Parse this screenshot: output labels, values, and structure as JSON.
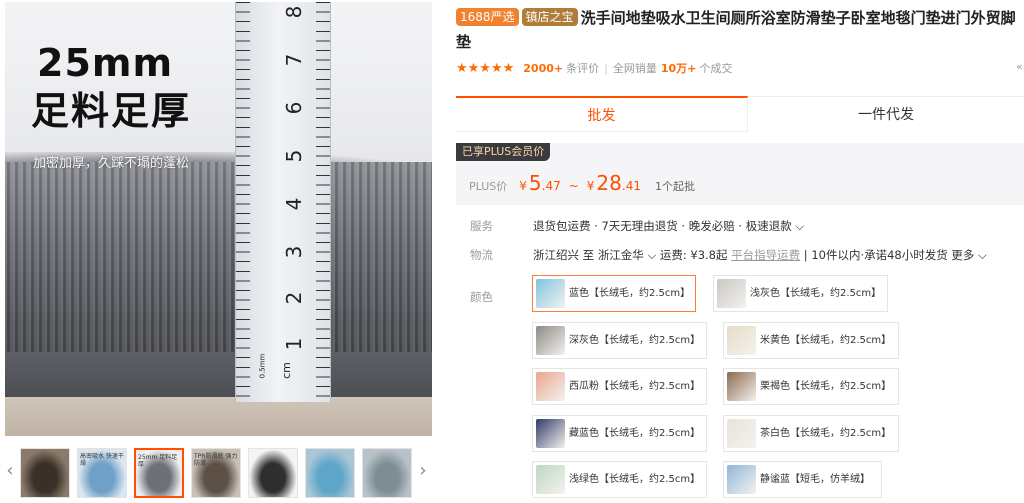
{
  "gallery": {
    "main_heading_1": "25mm",
    "main_heading_2": "足料足厚",
    "main_sub": "加密加厚，久踩不塌的蓬松",
    "ruler_numbers": [
      "8",
      "7",
      "6",
      "5",
      "4",
      "3",
      "2",
      "1"
    ],
    "ruler_unit_cm": "cm",
    "ruler_unit_mm": "0.5mm",
    "thumb_prev": "‹",
    "thumb_next": "›",
    "thumbs": [
      {
        "caption": "",
        "bg": "#8b7a6a",
        "alt": "#3a3028"
      },
      {
        "caption": "高密吸水 快速干燥",
        "bg": "#dbe8f2",
        "alt": "#6fa0c8"
      },
      {
        "caption": "25mm 足料足厚",
        "bg": "#eeeef0",
        "alt": "#6e7077"
      },
      {
        "caption": "TPR防滑底 强力防滑",
        "bg": "#c9c1b8",
        "alt": "#5c5047"
      },
      {
        "caption": "",
        "bg": "#f4f4f4",
        "alt": "#2e2e30"
      },
      {
        "caption": "",
        "bg": "#a9c6d6",
        "alt": "#5da6c9"
      },
      {
        "caption": "",
        "bg": "#b8c2c8",
        "alt": "#7f8e96"
      }
    ]
  },
  "product": {
    "badge_1688": "1688严选",
    "badge_shop": "镇店之宝",
    "title": "洗手间地垫吸水卫生间厕所浴室防滑垫子卧室地毯门垫进门外贸脚垫",
    "stars": "★★★★★",
    "review_count": "2000+",
    "review_label": "条评价",
    "sep": "|",
    "sales_label": "全网销量",
    "sales_count": "10万+",
    "sales_unit": "个成交",
    "more": "«"
  },
  "tabs": [
    "批发",
    "一件代发"
  ],
  "price": {
    "plus_tag": "已享PLUS会员价",
    "plus_label": "PLUS价",
    "yen": "¥",
    "low_int": "5",
    "low_dec": ".47",
    "tilde": "~",
    "high_int": "28",
    "high_dec": ".41",
    "min_order": "1个起批"
  },
  "service": {
    "label": "服务",
    "value": "退货包运费 · 7天无理由退货 · 晚发必赔 · 极速退款 ⌵"
  },
  "logistics": {
    "label": "物流",
    "from": "浙江绍兴",
    "to_word": "至",
    "to": "浙江金华 ⌵",
    "fee": "运费: ¥3.8起",
    "fee_note": "平台指导运费",
    "delivery": "| 10件以内·承诺48小时发货",
    "more": "更多 ⌵"
  },
  "color_label": "颜色",
  "colors": {
    "selected_color": "#ff7a3d",
    "options": [
      {
        "label": "蓝色【长绒毛，约2.5cm】",
        "swatch": "#7ec4de"
      },
      {
        "label": "浅灰色【长绒毛，约2.5cm】",
        "swatch": "#c9c7c2"
      },
      {
        "label": "深灰色【长绒毛，约2.5cm】",
        "swatch": "#8e8a85"
      },
      {
        "label": "米黄色【长绒毛，约2.5cm】",
        "swatch": "#e6dcc6"
      },
      {
        "label": "西瓜粉【长绒毛，约2.5cm】",
        "swatch": "#e9a58f"
      },
      {
        "label": "栗褐色【长绒毛，约2.5cm】",
        "swatch": "#8c6a4e"
      },
      {
        "label": "藏蓝色【长绒毛，约2.5cm】",
        "swatch": "#2f3b66"
      },
      {
        "label": "茶白色【长绒毛，约2.5cm】",
        "swatch": "#e9e4da"
      },
      {
        "label": "浅绿色【长绒毛，约2.5cm】",
        "swatch": "#bcd8c0"
      },
      {
        "label": "静谧蓝【短毛，仿羊绒】",
        "swatch": "#8fb6d6"
      }
    ]
  }
}
